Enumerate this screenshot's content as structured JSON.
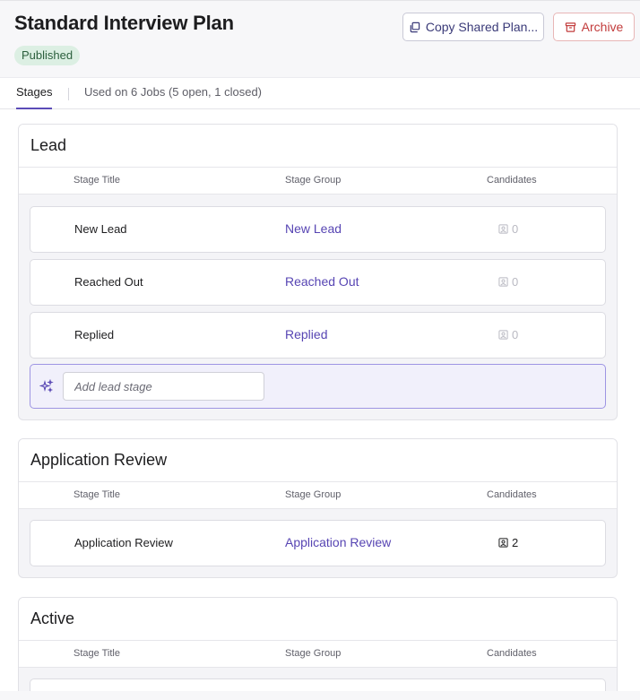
{
  "header": {
    "title": "Standard Interview Plan",
    "status": "Published",
    "copy_button": "Copy Shared Plan...",
    "archive_button": "Archive"
  },
  "tabs": {
    "stages": "Stages",
    "used_on": "Used on 6 Jobs (5 open, 1 closed)"
  },
  "columns": {
    "title": "Stage Title",
    "group": "Stage Group",
    "candidates": "Candidates"
  },
  "sections": [
    {
      "name": "Lead",
      "rows": [
        {
          "title": "New Lead",
          "group": "New Lead",
          "candidates": "0"
        },
        {
          "title": "Reached Out",
          "group": "Reached Out",
          "candidates": "0"
        },
        {
          "title": "Replied",
          "group": "Replied",
          "candidates": "0"
        }
      ],
      "add_placeholder": "Add lead stage"
    },
    {
      "name": "Application Review",
      "rows": [
        {
          "title": "Application Review",
          "group": "Application Review",
          "candidates": "2"
        }
      ]
    },
    {
      "name": "Active",
      "rows": []
    }
  ],
  "colors": {
    "accent": "#5745b3",
    "archive": "#c23b3b",
    "badge_bg": "#dcefe3"
  }
}
